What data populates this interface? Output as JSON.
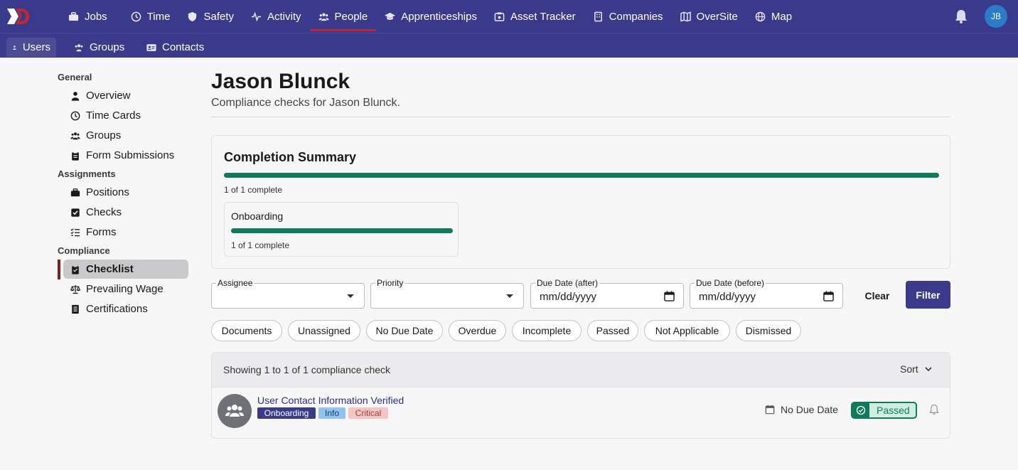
{
  "topnav": {
    "items": [
      {
        "label": "Jobs",
        "icon": "briefcase-icon"
      },
      {
        "label": "Time",
        "icon": "clock-icon"
      },
      {
        "label": "Safety",
        "icon": "shield-icon"
      },
      {
        "label": "Activity",
        "icon": "activity-icon"
      },
      {
        "label": "People",
        "icon": "people-icon",
        "active": true
      },
      {
        "label": "Apprenticeships",
        "icon": "graduation-cap-icon"
      },
      {
        "label": "Asset Tracker",
        "icon": "asset-icon"
      },
      {
        "label": "Companies",
        "icon": "building-icon"
      },
      {
        "label": "OverSite",
        "icon": "map-book-icon"
      },
      {
        "label": "Map",
        "icon": "globe-icon"
      }
    ],
    "avatar_initials": "JB"
  },
  "subnav": {
    "items": [
      {
        "label": "Users",
        "active": true
      },
      {
        "label": "Groups"
      },
      {
        "label": "Contacts"
      }
    ]
  },
  "sidebar": {
    "sections": [
      {
        "heading": "General",
        "items": [
          "Overview",
          "Time Cards",
          "Groups",
          "Form Submissions"
        ]
      },
      {
        "heading": "Assignments",
        "items": [
          "Positions",
          "Checks",
          "Forms"
        ]
      },
      {
        "heading": "Compliance",
        "items": [
          "Checklist",
          "Prevailing Wage",
          "Certifications"
        ]
      }
    ],
    "active_item": "Checklist"
  },
  "main": {
    "title": "Jason Blunck",
    "subtitle": "Compliance checks for Jason Blunck."
  },
  "summary": {
    "title": "Completion Summary",
    "overall_fraction": 1.0,
    "overall_count": "1 of 1 complete",
    "groups": [
      {
        "name": "Onboarding",
        "fraction": 1.0,
        "count": "1 of 1 complete"
      }
    ]
  },
  "filters": {
    "assignee_label": "Assignee",
    "priority_label": "Priority",
    "due_after_label": "Due Date (after)",
    "due_before_label": "Due Date (before)",
    "date_placeholder": "mm/dd/yyyy",
    "clear_label": "Clear",
    "filter_label": "Filter",
    "chips": [
      "Documents",
      "Unassigned",
      "No Due Date",
      "Overdue",
      "Incomplete",
      "Passed",
      "Not Applicable",
      "Dismissed"
    ]
  },
  "results": {
    "count_text": "Showing 1 to 1 of 1 compliance check",
    "sort_label": "Sort",
    "rows": [
      {
        "title": "User Contact Information Verified",
        "tags": [
          "Onboarding",
          "Info",
          "Critical"
        ],
        "due": "No Due Date",
        "status": "Passed"
      }
    ]
  },
  "colors": {
    "nav_bg": "#3a3a8c",
    "accent_red": "#c0292b",
    "success_green": "#0f7b5c",
    "avatar_blue": "#2a7ec7"
  }
}
